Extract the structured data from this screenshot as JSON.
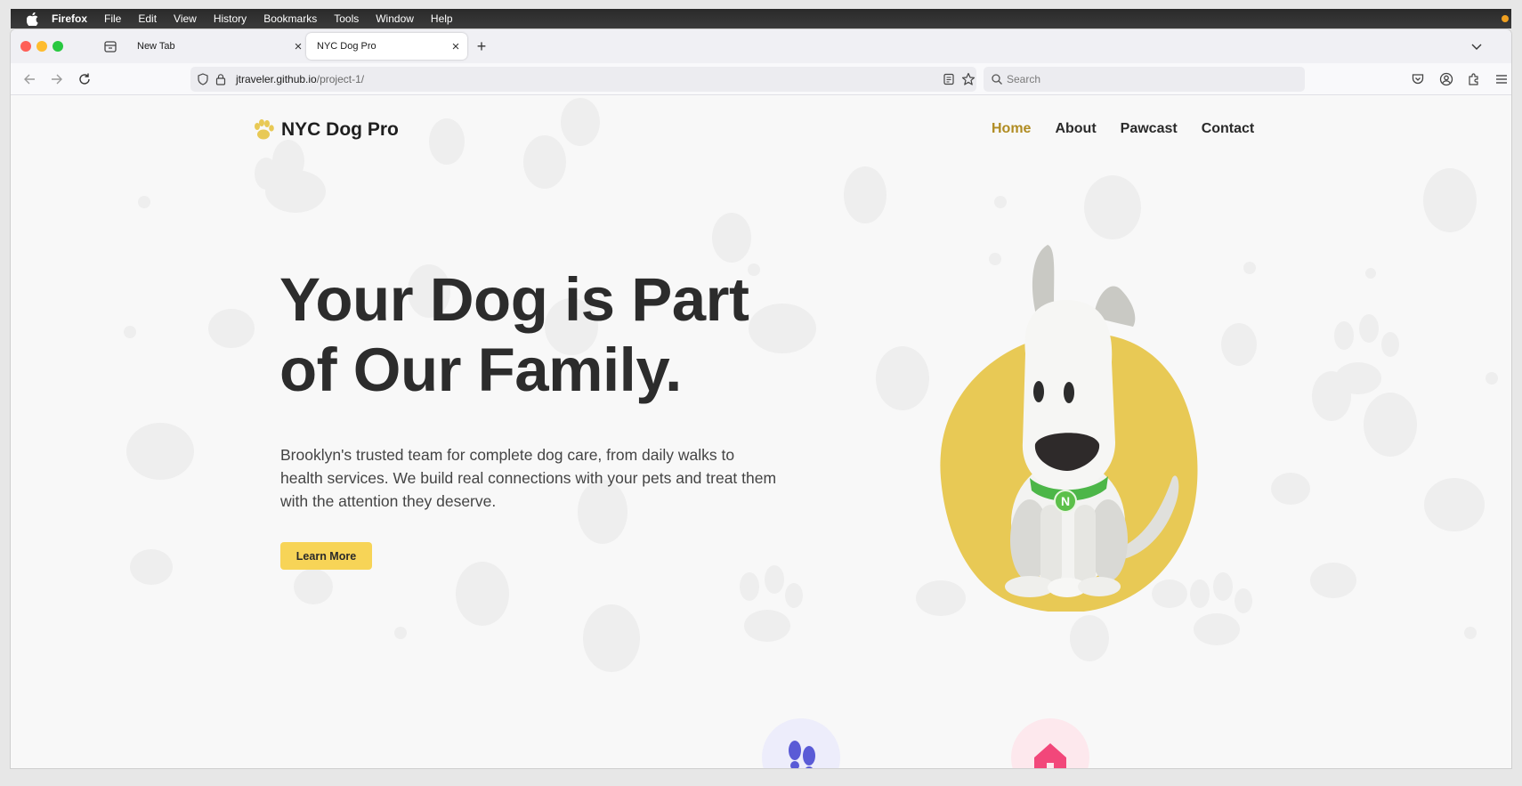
{
  "os_menubar": {
    "items": [
      "Firefox",
      "File",
      "Edit",
      "View",
      "History",
      "Bookmarks",
      "Tools",
      "Window",
      "Help"
    ]
  },
  "browser": {
    "tabs": [
      {
        "title": "New Tab",
        "active": false
      },
      {
        "title": "NYC Dog Pro",
        "active": true
      }
    ],
    "new_tab_label": "+",
    "url_host": "jtraveler.github.io",
    "url_path": "/project-1/",
    "search_placeholder": "Search"
  },
  "site": {
    "brand": "NYC Dog Pro",
    "nav": [
      {
        "label": "Home",
        "active": true
      },
      {
        "label": "About",
        "active": false
      },
      {
        "label": "Pawcast",
        "active": false
      },
      {
        "label": "Contact",
        "active": false
      }
    ],
    "hero": {
      "title_line1": "Your Dog is Part",
      "title_line2": "of Our Family.",
      "description": "Brooklyn's trusted team for complete dog care, from daily walks to health services. We build real connections with your pets and treat them with the attention they deserve.",
      "cta_label": "Learn More"
    },
    "dog_collar_letter": "N",
    "feature_icons": [
      "footprints-icon",
      "home-icon"
    ]
  },
  "colors": {
    "accent_yellow": "#e8c955",
    "nav_active": "#b08c22",
    "button_bg": "#f7d457",
    "collar_green": "#4cb648",
    "feature_icon_1_bg": "#ededfb",
    "feature_icon_2_bg": "#fde8ed"
  }
}
